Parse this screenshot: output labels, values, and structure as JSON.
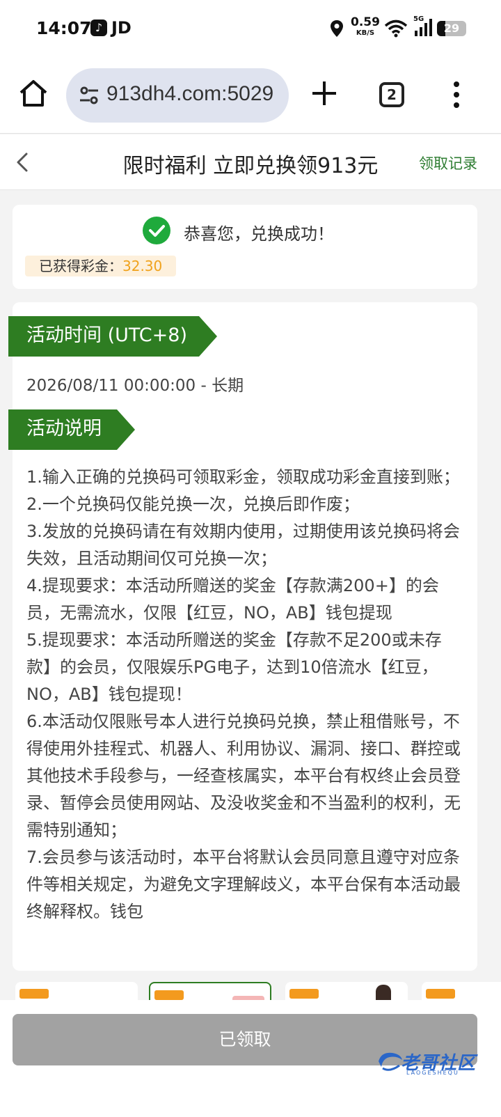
{
  "status_bar": {
    "time": "14:07",
    "app_icon": "tiktok-icon",
    "app_label": "JD",
    "net_speed": "0.59",
    "net_unit": "KB/S",
    "network_type": "5G",
    "battery": "29"
  },
  "browser": {
    "url": "913dh4.com:5029",
    "tab_count": "2"
  },
  "header": {
    "title": "限时福利 立即兑换领913元",
    "record_link": "领取记录"
  },
  "success": {
    "message": "恭喜您，兑换成功！",
    "bonus_label": "已获得彩金：",
    "bonus_value": "32.30"
  },
  "activity": {
    "time_tag": "活动时间 (UTC+8)",
    "time_value": "2026/08/11 00:00:00 - 长期",
    "desc_tag": "活动说明",
    "rules": [
      "1.输入正确的兑换码可领取彩金，领取成功彩金直接到账；",
      "2.一个兑换码仅能兑换一次，兑换后即作废；",
      "3.发放的兑换码请在有效期内使用，过期使用该兑换码将会失效，且活动期间仅可兑换一次；",
      "4.提现要求：本活动所赠送的奖金【存款满200+】的会员，无需流水，仅限【红豆，NO，AB】钱包提现",
      "5.提现要求：本活动所赠送的奖金【存款不足200或未存款】的会员，仅限娱乐PG电子，达到10倍流水【红豆，NO，AB】钱包提现！",
      "6.本活动仅限账号本人进行兑换码兑换，禁止租借账号，不得使用外挂程式、机器人、利用协议、漏洞、接口、群控或其他技术手段参与，一经查核属实，本平台有权终止会员登录、暂停会员使用网站、及没收奖金和不当盈利的权利，无需特别通知；",
      "7.会员参与该活动时，本平台将默认会员同意且遵守对应条件等相关规定，为避免文字理解歧义，本平台保有本活动最终解释权。钱包"
    ]
  },
  "bottom": {
    "claim_button": "已领取",
    "watermark": "老哥社区",
    "watermark_sub": "LAOGESHEQU"
  },
  "colors": {
    "accent_green": "#2e7d22",
    "success_green": "#1faa3c",
    "bonus_orange": "#f0a21c",
    "disabled_gray": "#a2a2a2"
  }
}
